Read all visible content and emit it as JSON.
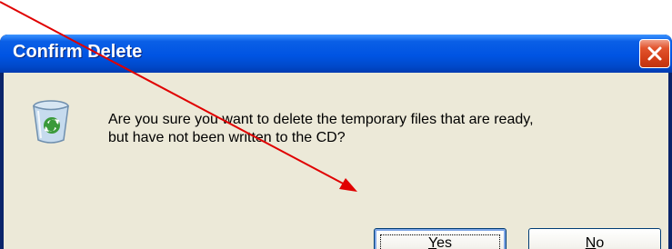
{
  "dialog": {
    "title": "Confirm Delete",
    "message_line1": "Are you sure you want to delete the temporary files that are ready,",
    "message_line2": "but have not been written to the CD?",
    "icon": "recycle-bin-icon"
  },
  "buttons": {
    "yes_mnemonic": "Y",
    "yes_rest": "es",
    "no_mnemonic": "N",
    "no_rest": "o"
  },
  "colors": {
    "title_bar": "#0054e3",
    "dialog_bg": "#ece9d8",
    "close_button": "#d23e17",
    "annotation_arrow": "#e00000"
  }
}
